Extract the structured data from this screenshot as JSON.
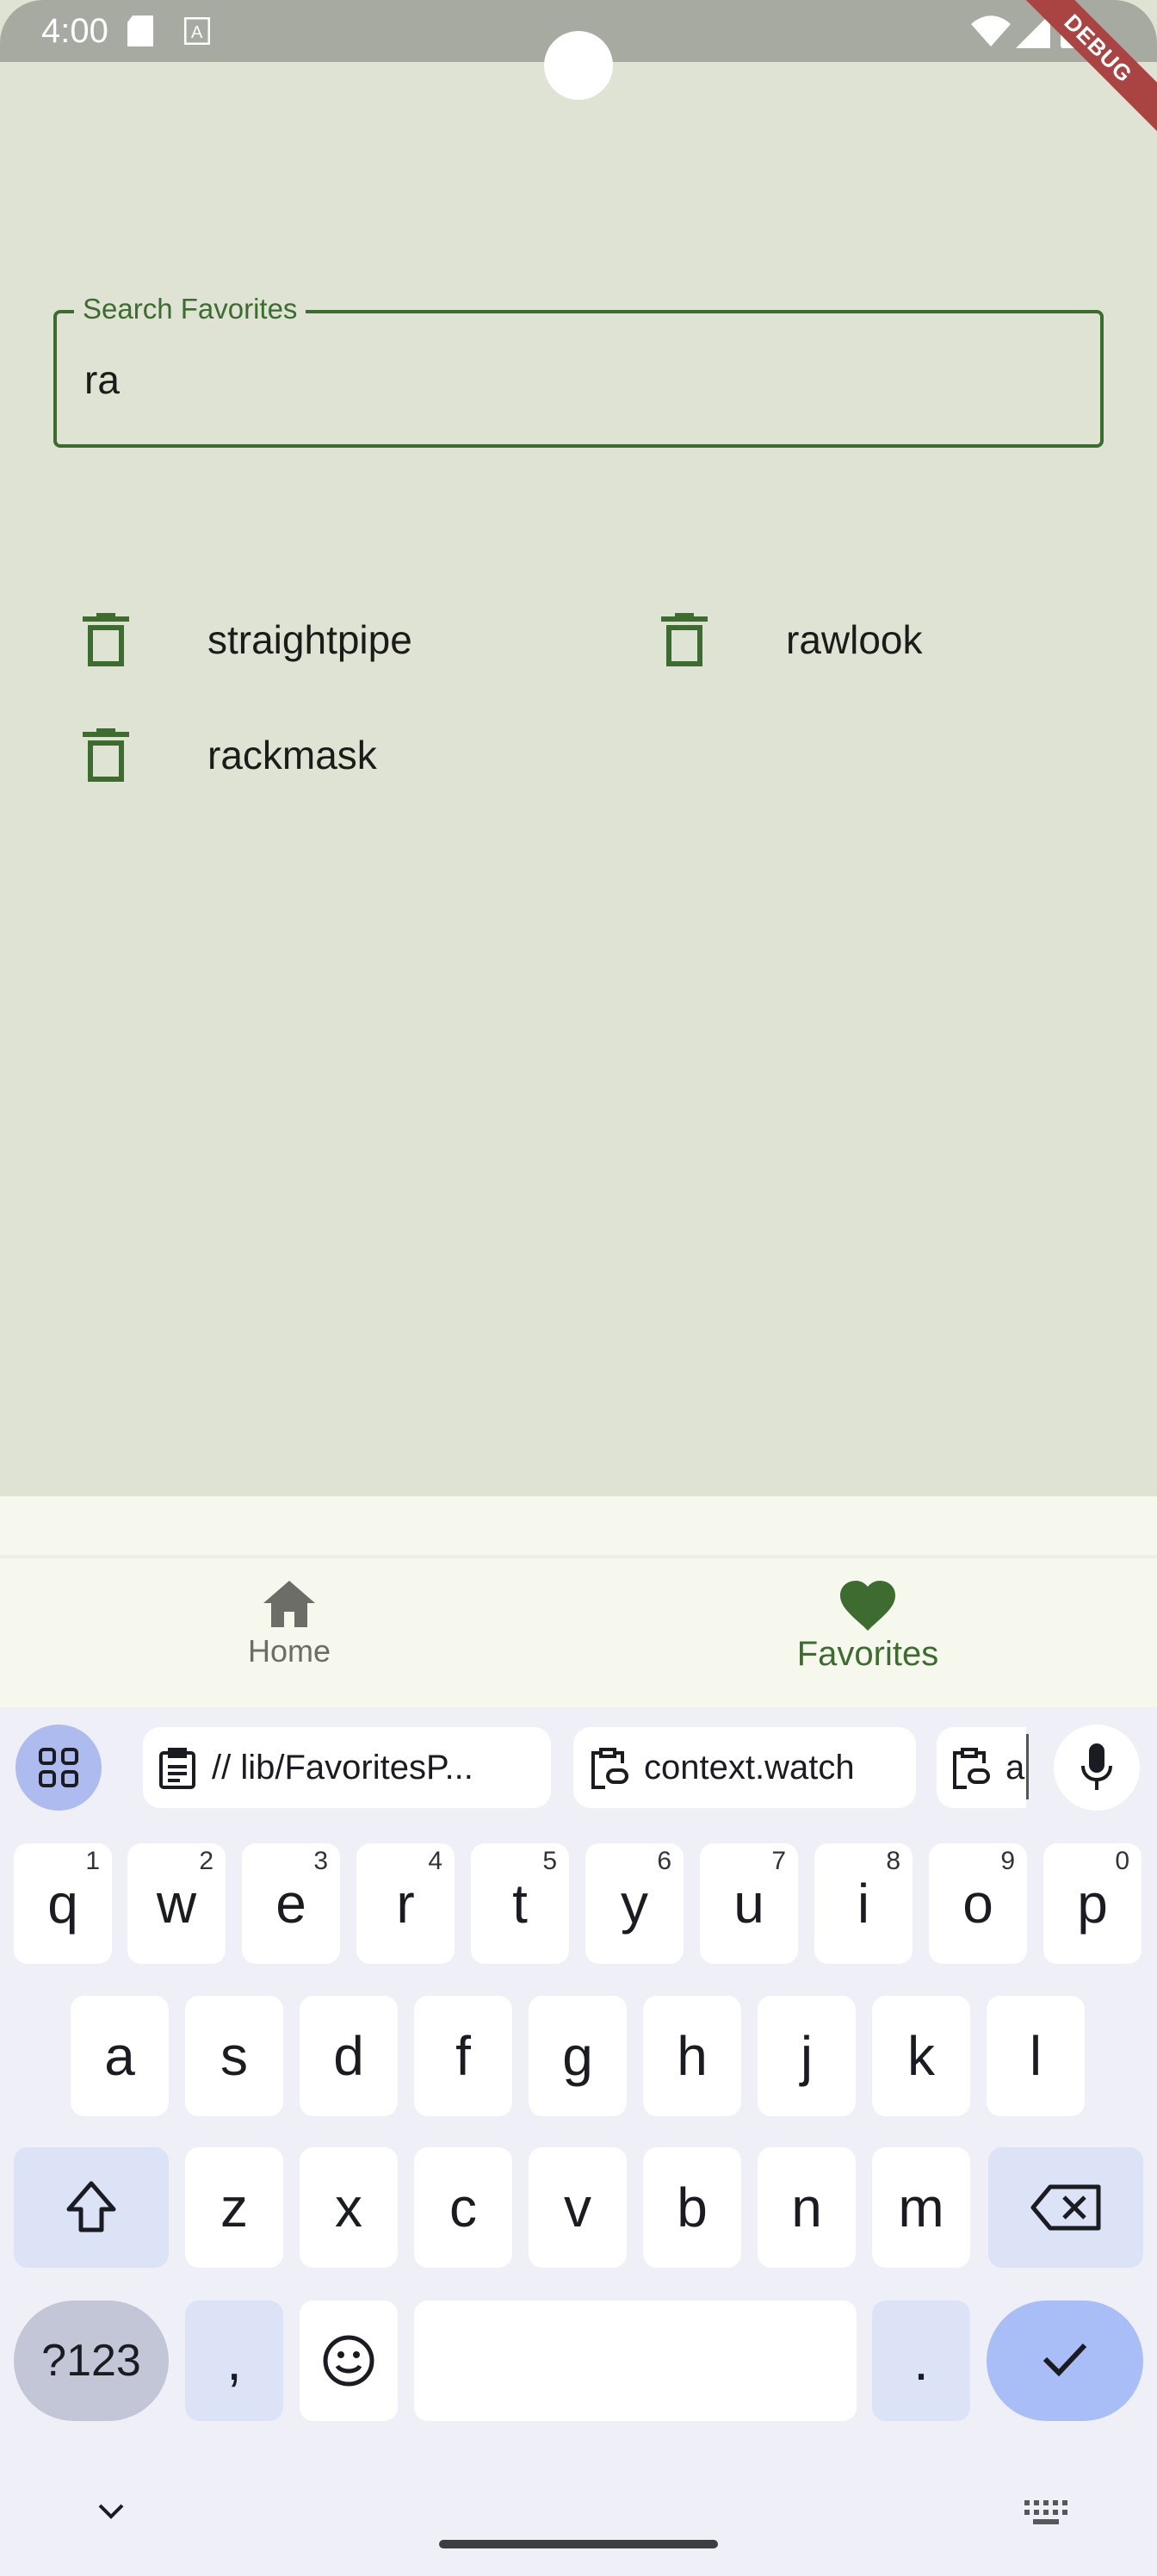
{
  "status": {
    "time": "4:00",
    "debug": "DEBUG"
  },
  "search": {
    "label": "Search Favorites",
    "value": "ra"
  },
  "favorites": {
    "items": [
      {
        "label": "straightpipe"
      },
      {
        "label": "rawlook"
      },
      {
        "label": "rackmask"
      }
    ]
  },
  "nav": {
    "home": "Home",
    "favorites": "Favorites",
    "active_color": "#3e6b2f",
    "inactive_color": "#6b6d66"
  },
  "keyboard": {
    "suggestions": [
      "// lib/FavoritesP...",
      "context.watch",
      "a"
    ],
    "row1": [
      {
        "k": "q",
        "h": "1"
      },
      {
        "k": "w",
        "h": "2"
      },
      {
        "k": "e",
        "h": "3"
      },
      {
        "k": "r",
        "h": "4"
      },
      {
        "k": "t",
        "h": "5"
      },
      {
        "k": "y",
        "h": "6"
      },
      {
        "k": "u",
        "h": "7"
      },
      {
        "k": "i",
        "h": "8"
      },
      {
        "k": "o",
        "h": "9"
      },
      {
        "k": "p",
        "h": "0"
      }
    ],
    "row2": [
      "a",
      "s",
      "d",
      "f",
      "g",
      "h",
      "j",
      "k",
      "l"
    ],
    "row3": [
      "z",
      "x",
      "c",
      "v",
      "b",
      "n",
      "m"
    ],
    "symbols": "?123",
    "comma": ",",
    "period": "."
  }
}
